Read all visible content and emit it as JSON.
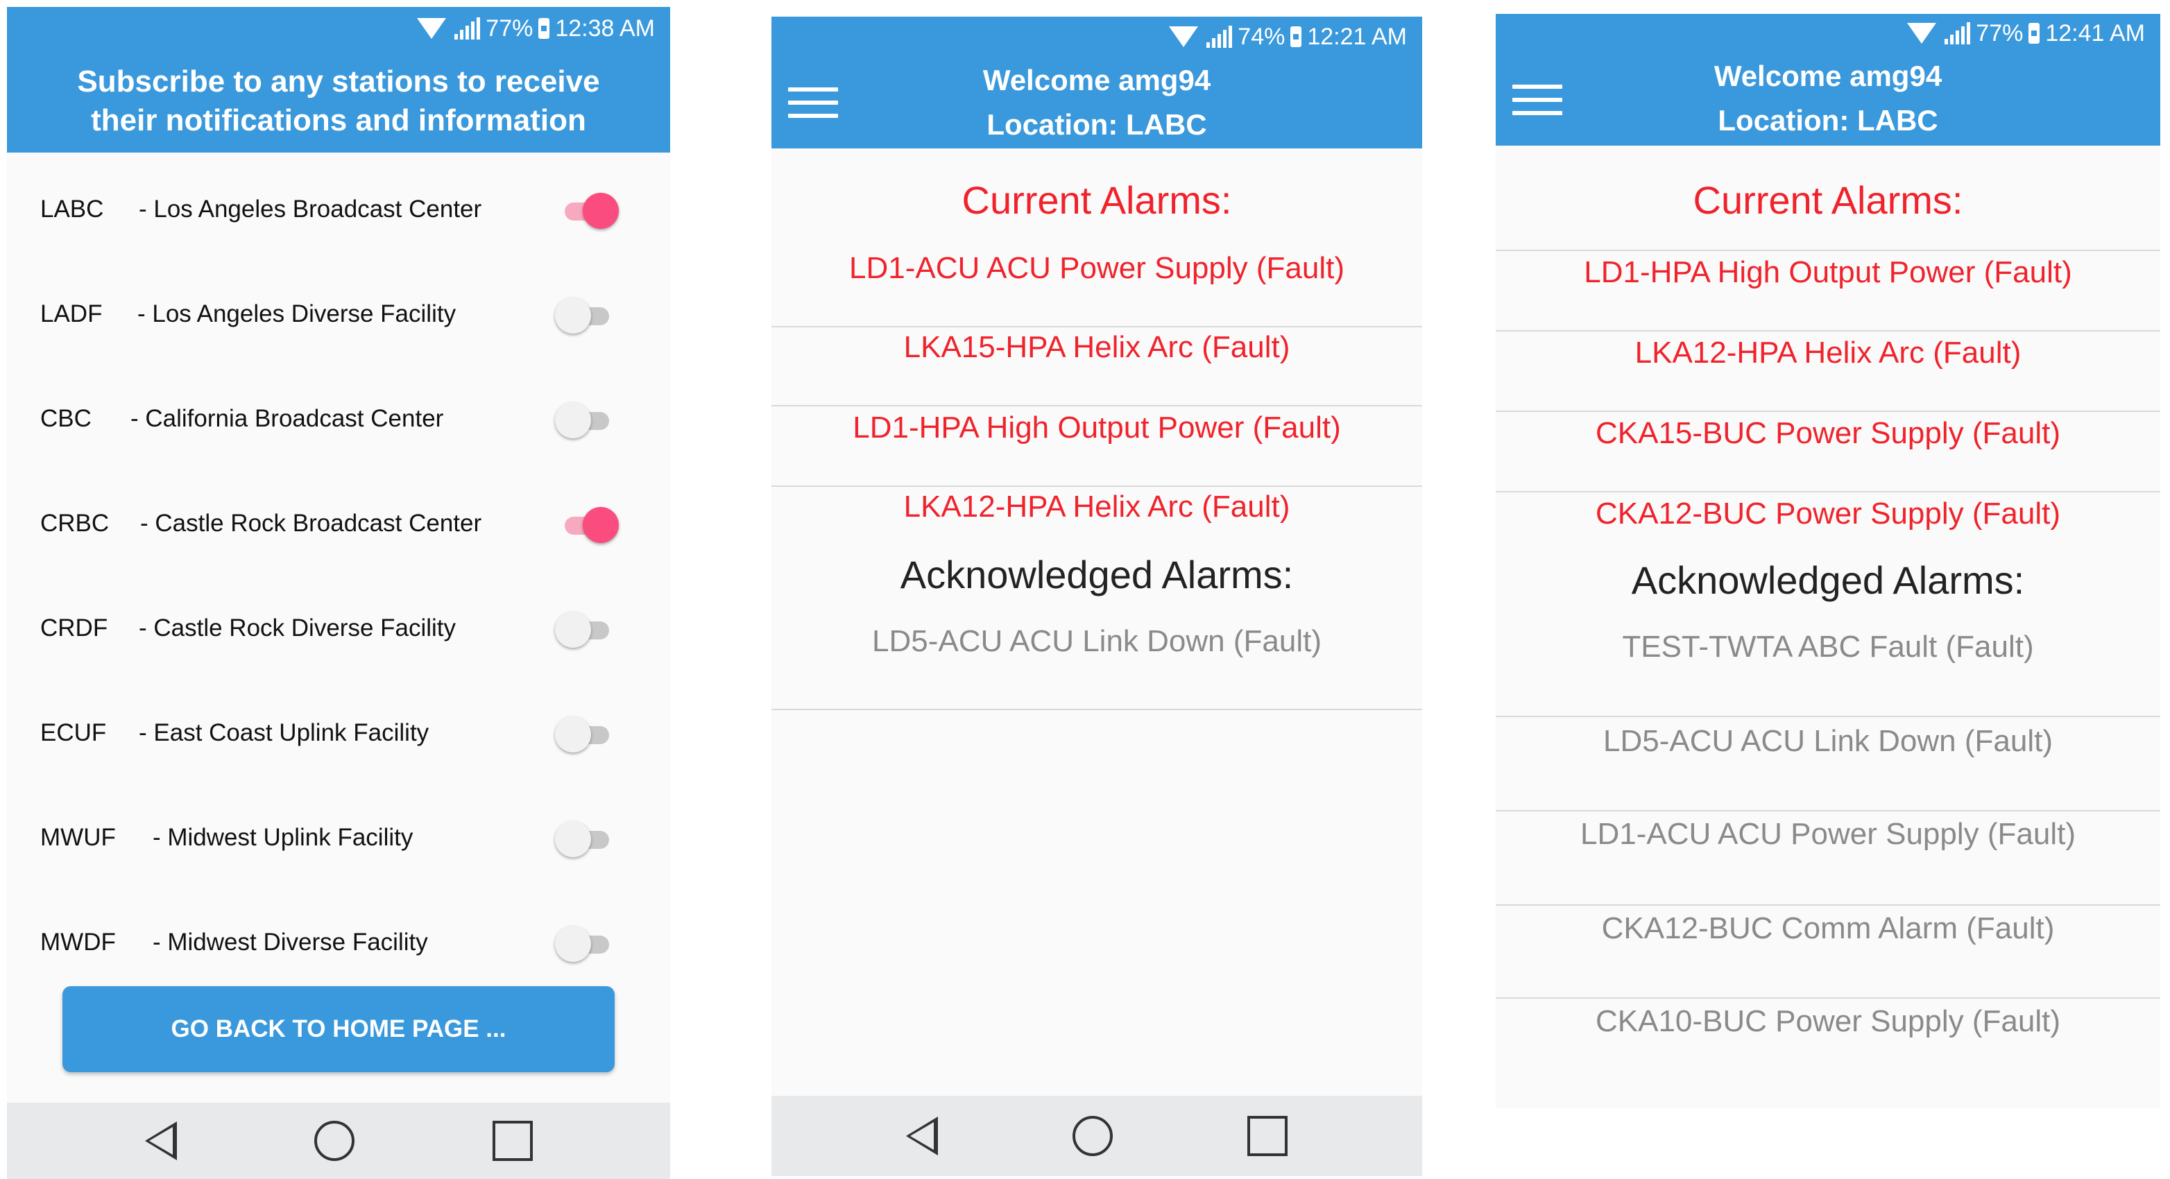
{
  "screen1": {
    "status": {
      "battery": "77%",
      "time": "12:38 AM"
    },
    "header": {
      "line1": "Subscribe to any stations to receive",
      "line2": "their notifications and information"
    },
    "stations": [
      {
        "code": "LABC",
        "name": "- Los Angeles Broadcast Center",
        "on": true
      },
      {
        "code": "LADF",
        "name": "- Los Angeles Diverse Facility",
        "on": false
      },
      {
        "code": "CBC",
        "name": "- California Broadcast Center",
        "on": false
      },
      {
        "code": "CRBC",
        "name": "- Castle Rock Broadcast Center",
        "on": true
      },
      {
        "code": "CRDF",
        "name": "- Castle Rock Diverse Facility",
        "on": false
      },
      {
        "code": "ECUF",
        "name": "- East Coast Uplink Facility",
        "on": false
      },
      {
        "code": "MWUF",
        "name": "- Midwest Uplink Facility",
        "on": false
      },
      {
        "code": "MWDF",
        "name": "- Midwest Diverse Facility",
        "on": false
      }
    ],
    "home_button": "GO BACK TO HOME PAGE ..."
  },
  "screen2": {
    "status": {
      "battery": "74%",
      "time": "12:21 AM"
    },
    "header": {
      "welcome": "Welcome  amg94",
      "location": "Location:  LABC"
    },
    "current_title": "Current Alarms:",
    "current_alarms": [
      "LD1-ACU ACU Power Supply (Fault)",
      "LKA15-HPA Helix Arc (Fault)",
      "LD1-HPA High Output Power (Fault)",
      "LKA12-HPA Helix Arc (Fault)"
    ],
    "ack_title": "Acknowledged Alarms:",
    "ack_alarms": [
      "LD5-ACU ACU Link Down (Fault)"
    ]
  },
  "screen3": {
    "status": {
      "battery": "77%",
      "time": "12:41 AM"
    },
    "header": {
      "welcome": "Welcome  amg94",
      "location": "Location:  LABC"
    },
    "current_title": "Current Alarms:",
    "current_alarms": [
      "LD1-HPA High Output Power (Fault)",
      "LKA12-HPA Helix Arc (Fault)",
      "CKA15-BUC Power Supply (Fault)",
      "CKA12-BUC Power Supply (Fault)"
    ],
    "ack_title": "Acknowledged Alarms:",
    "ack_alarms": [
      "TEST-TWTA  ABC Fault (Fault)",
      "LD5-ACU ACU Link Down (Fault)",
      "LD1-ACU ACU Power Supply (Fault)",
      "CKA12-BUC Comm Alarm (Fault)",
      "CKA10-BUC Power Supply (Fault)"
    ]
  },
  "colors": {
    "primary": "#3a99dc",
    "alarm_red": "#f0232c",
    "ack_gray": "#8a8a8a",
    "toggle_on": "#fb4c7f"
  }
}
